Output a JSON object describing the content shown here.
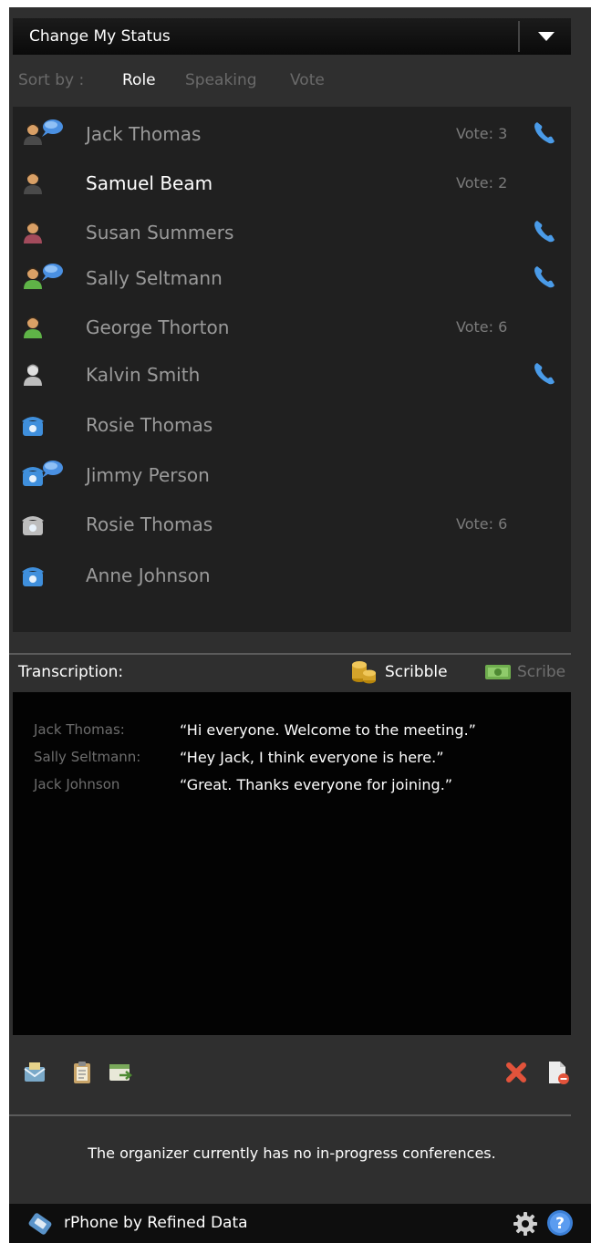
{
  "status": {
    "label": "Change My Status"
  },
  "sort": {
    "prefix": "Sort by :",
    "options": [
      "Role",
      "Speaking",
      "Vote"
    ],
    "active": "Role"
  },
  "participants": [
    {
      "name": "Jack Thomas",
      "vote": "Vote: 3",
      "phone": true,
      "speaking": true,
      "avatar": "person-dark-icon"
    },
    {
      "name": "Samuel Beam",
      "vote": "Vote: 2",
      "phone": false,
      "speaking": false,
      "avatar": "person-dark-icon",
      "selected": true
    },
    {
      "name": "Susan Summers",
      "vote": "",
      "phone": true,
      "speaking": false,
      "avatar": "person-red-icon"
    },
    {
      "name": "Sally Seltmann",
      "vote": "",
      "phone": true,
      "speaking": true,
      "avatar": "person-green-icon"
    },
    {
      "name": "George Thorton",
      "vote": "Vote: 6",
      "phone": false,
      "speaking": false,
      "avatar": "person-green-icon"
    },
    {
      "name": "Kalvin Smith",
      "vote": "",
      "phone": true,
      "speaking": false,
      "avatar": "person-gray-icon"
    },
    {
      "name": "Rosie Thomas",
      "vote": "",
      "phone": false,
      "speaking": false,
      "avatar": "telephone-blue-icon"
    },
    {
      "name": "Jimmy Person",
      "vote": "",
      "phone": false,
      "speaking": true,
      "avatar": "telephone-blue-icon"
    },
    {
      "name": "Rosie Thomas",
      "vote": "Vote: 6",
      "phone": false,
      "speaking": false,
      "avatar": "telephone-gray-icon"
    },
    {
      "name": "Anne Johnson",
      "vote": "",
      "phone": false,
      "speaking": false,
      "avatar": "telephone-blue-icon"
    }
  ],
  "transcription": {
    "label": "Transcription:",
    "scribble_label": "Scribble",
    "scribe_label": "Scribe",
    "lines": [
      {
        "speaker": "Jack Thomas:",
        "text": "“Hi everyone. Welcome to the meeting.”"
      },
      {
        "speaker": "Sally Seltmann:",
        "text": "“Hey Jack, I think everyone is here.”"
      },
      {
        "speaker": "Jack Johnson",
        "text": " “Great. Thanks everyone for joining.”"
      }
    ]
  },
  "toolbar": {
    "left_icons": [
      "email-icon",
      "clipboard-icon",
      "export-icon"
    ],
    "right_icons": [
      "delete-icon",
      "document-remove-icon"
    ]
  },
  "notice": "The organizer currently has no in-progress conferences.",
  "footer": {
    "brand": "rPhone by Refined Data",
    "icons": [
      "rphone-logo-icon",
      "gear-icon",
      "help-icon"
    ]
  },
  "colors": {
    "panel": "#2f2f2f",
    "list_bg": "#202020",
    "transcript_bg": "#030303",
    "phone_blue": "#4a9be8"
  }
}
